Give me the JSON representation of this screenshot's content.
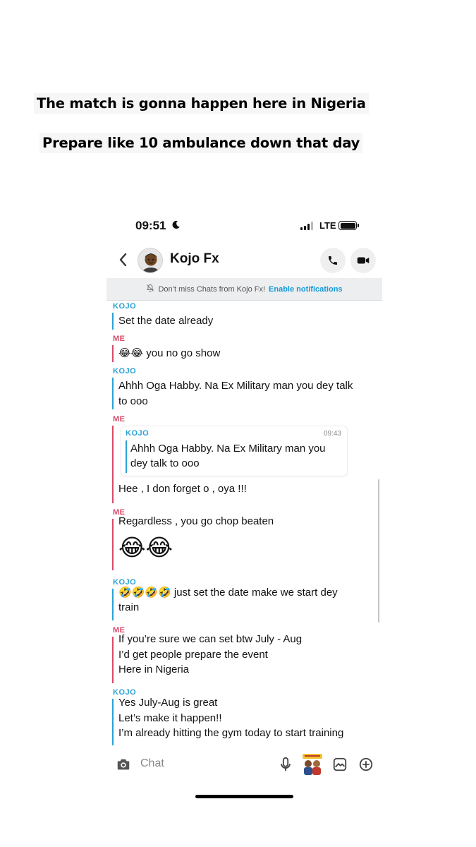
{
  "captions": {
    "line1": "The match is gonna happen here in Nigeria",
    "line2": "Prepare like 10 ambulance down that day"
  },
  "status_bar": {
    "time": "09:51",
    "network": "LTE"
  },
  "header": {
    "contact_name": "Kojo Fx"
  },
  "notification_banner": {
    "text": "Don’t miss Chats from Kojo Fx!",
    "action": "Enable notifications"
  },
  "colors": {
    "kojo": "#2aa2d5",
    "me": "#d84a68",
    "link": "#169ad8"
  },
  "messages": [
    {
      "sender": "KOJO",
      "lines": [
        "Set the date already"
      ]
    },
    {
      "sender": "ME",
      "lines": [
        "😂😂 you no go show"
      ]
    },
    {
      "sender": "KOJO",
      "lines": [
        "Ahhh Oga Habby. Na Ex Military man you dey talk",
        "to ooo"
      ]
    },
    {
      "sender": "ME",
      "quote": {
        "sender": "KOJO",
        "time": "09:43",
        "lines": [
          "Ahhh Oga Habby. Na Ex Military man you",
          "dey talk to ooo"
        ]
      },
      "lines": [
        "Hee , I don forget o , oya !!!"
      ]
    },
    {
      "sender": "ME",
      "lines": [
        "Regardless , you go chop beaten"
      ],
      "big_emoji": "😂😂"
    },
    {
      "sender": "KOJO",
      "lines": [
        "🤣🤣🤣🤣 just set the date make we start dey",
        "train"
      ]
    },
    {
      "sender": "ME",
      "lines": [
        "If you’re sure we can set btw  July - Aug",
        "I’d get people prepare the event",
        "Here in Nigeria"
      ]
    },
    {
      "sender": "KOJO",
      "lines": [
        "Yes July-Aug is great",
        "Let’s make it happen!!",
        "I’m already hitting the gym today to start training"
      ]
    }
  ],
  "composer": {
    "placeholder": "Chat"
  },
  "icons": {
    "back": "chevron-left-icon",
    "call": "phone-icon",
    "video": "video-camera-icon",
    "bell_off": "bell-off-icon",
    "camera": "camera-icon",
    "mic": "microphone-icon",
    "sticker": "bitmoji-sticker-icon",
    "gallery": "gallery-icon",
    "plus": "plus-circle-icon"
  }
}
